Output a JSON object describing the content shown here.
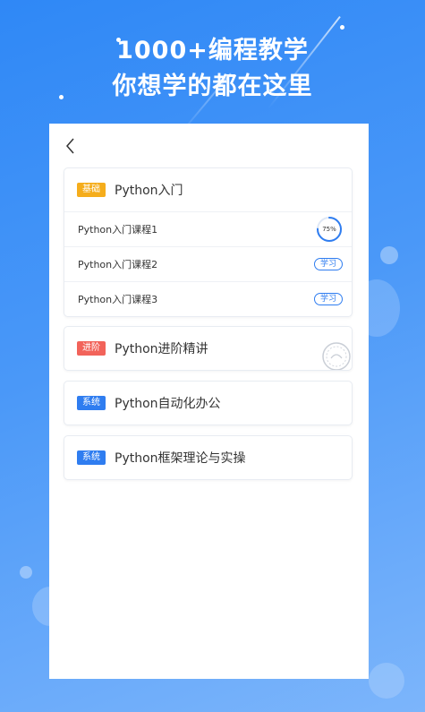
{
  "promo": {
    "line1": "1000+编程教学",
    "line2": "你想学的都在这里"
  },
  "colors": {
    "background_top": "#2f88f6",
    "basic_badge": "#f5ad1c",
    "advanced_badge": "#f2635a",
    "system_badge": "#2f7df0",
    "accent": "#2f7df0"
  },
  "nav": {
    "back_icon": "chevron-left-icon"
  },
  "courses": [
    {
      "badge": "基础",
      "title": "Python入门",
      "lessons": [
        {
          "label": "Python入门课程1",
          "progress_text": "75%",
          "progress": 0.75
        },
        {
          "label": "Python入门课程2",
          "action": "学习"
        },
        {
          "label": "Python入门课程3",
          "action": "学习"
        }
      ]
    },
    {
      "badge": "进阶",
      "title": "Python进阶精讲",
      "decoration": "seal-stamp-icon"
    },
    {
      "badge": "系统",
      "title": "Python自动化办公"
    },
    {
      "badge": "系统",
      "title": "Python框架理论与实操"
    }
  ]
}
